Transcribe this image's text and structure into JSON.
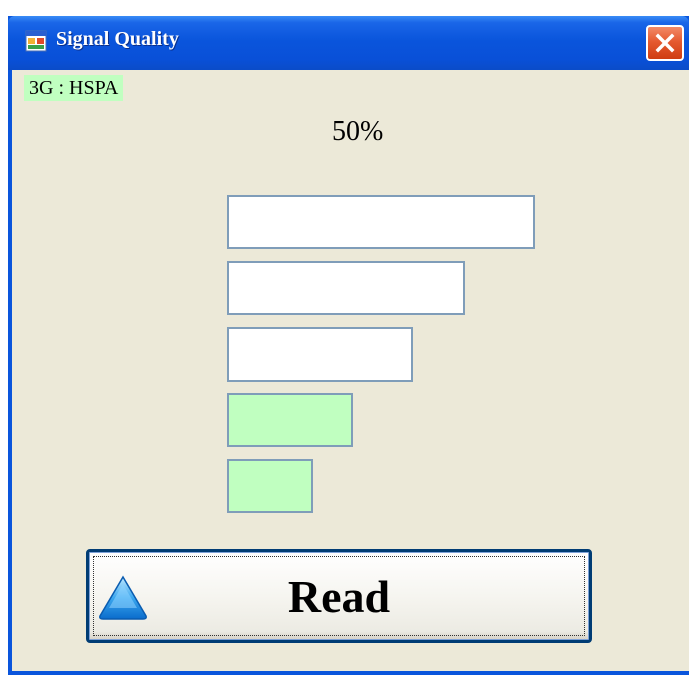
{
  "window": {
    "title": "Signal Quality",
    "icon": "window-app-icon",
    "close_icon": "close-x-icon"
  },
  "status": {
    "network_label": "3G : HSPA",
    "signal_percent_text": "50%",
    "signal_percent": 50
  },
  "signal_bars": {
    "total": 5,
    "lit": 2,
    "lit_color": "#c0ffc0",
    "unlit_color": "#ffffff",
    "border_color": "#7f9db9"
  },
  "read_button": {
    "label": "Read",
    "icon": "up-triangle-icon"
  },
  "colors": {
    "titlebar": "#0a55dc",
    "client_bg": "#ece9d8",
    "close_button": "#e55a30"
  }
}
